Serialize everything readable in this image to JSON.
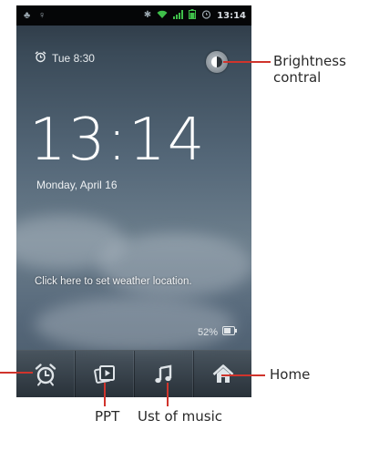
{
  "status_bar": {
    "time": "13:14"
  },
  "lockscreen": {
    "alarm_text": "Tue 8:30",
    "clock": "13:14",
    "date": "Monday, April 16",
    "weather_prompt": "Click here to set weather location.",
    "battery": "52%"
  },
  "dock": {
    "items": [
      {
        "icon": "alarm-clock-icon"
      },
      {
        "icon": "photo-gallery-icon"
      },
      {
        "icon": "music-note-icon"
      },
      {
        "icon": "home-icon"
      }
    ]
  },
  "callouts": {
    "brightness": "Brightness\ncontral",
    "home": "Home",
    "ppt": "PPT",
    "music": "Ust of music"
  },
  "colors": {
    "callout_line": "#d0342c",
    "signal_green": "#3fbf4a",
    "status_bar": "#050607"
  }
}
